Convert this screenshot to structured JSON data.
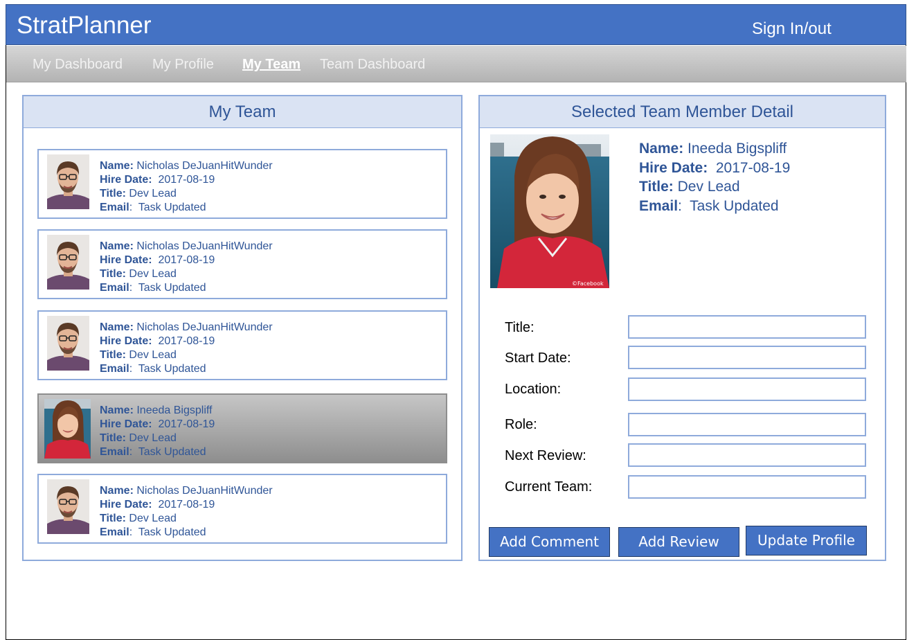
{
  "app": {
    "title": "StratPlanner",
    "sign_in_out": "Sign In/out"
  },
  "nav": {
    "items": [
      {
        "label": "My Dashboard"
      },
      {
        "label": "My Profile"
      },
      {
        "label": "My Team"
      },
      {
        "label": "Team Dashboard"
      }
    ],
    "active": "My Team"
  },
  "team_panel": {
    "title": "My Team",
    "labels": {
      "name": "Name:",
      "hire_date": "Hire Date:",
      "title": "Title:",
      "email": "Email"
    },
    "members": [
      {
        "name": "Nicholas DeJuanHitWunder",
        "hire_date": "2017-08-19",
        "title": "Dev Lead",
        "email": "Task Updated",
        "selected": false
      },
      {
        "name": "Nicholas DeJuanHitWunder",
        "hire_date": "2017-08-19",
        "title": "Dev Lead",
        "email": "Task Updated",
        "selected": false
      },
      {
        "name": "Nicholas DeJuanHitWunder",
        "hire_date": "2017-08-19",
        "title": "Dev Lead",
        "email": "Task Updated",
        "selected": false
      },
      {
        "name": "Ineeda Bigspliff",
        "hire_date": "2017-08-19",
        "title": "Dev Lead",
        "email": "Task Updated",
        "selected": true
      },
      {
        "name": "Nicholas DeJuanHitWunder",
        "hire_date": "2017-08-19",
        "title": "Dev Lead",
        "email": "Task Updated",
        "selected": false
      }
    ]
  },
  "detail_panel": {
    "title": "Selected Team Member Detail",
    "labels": {
      "name": "Name:",
      "hire_date": "Hire Date:",
      "title": "Title:",
      "email": "Email"
    },
    "member": {
      "name": "Ineeda Bigspliff",
      "hire_date": "2017-08-19",
      "title": "Dev Lead",
      "email": "Task Updated"
    },
    "photo_watermark": "©Facebook",
    "form": [
      {
        "label": "Title:",
        "value": ""
      },
      {
        "label": "Start Date:",
        "value": ""
      },
      {
        "label": "Location:",
        "value": ""
      },
      {
        "label": "Role:",
        "value": ""
      },
      {
        "label": "Next Review:",
        "value": ""
      },
      {
        "label": "Current Team:",
        "value": ""
      }
    ],
    "buttons": {
      "add_comment": "Add Comment",
      "add_review": "Add Review",
      "update_profile": "Update Profile"
    }
  },
  "colors": {
    "brand_blue": "#4472c4",
    "text_blue": "#2f5597",
    "border_blue": "#8eaadb",
    "header_fill": "#dae3f3"
  }
}
